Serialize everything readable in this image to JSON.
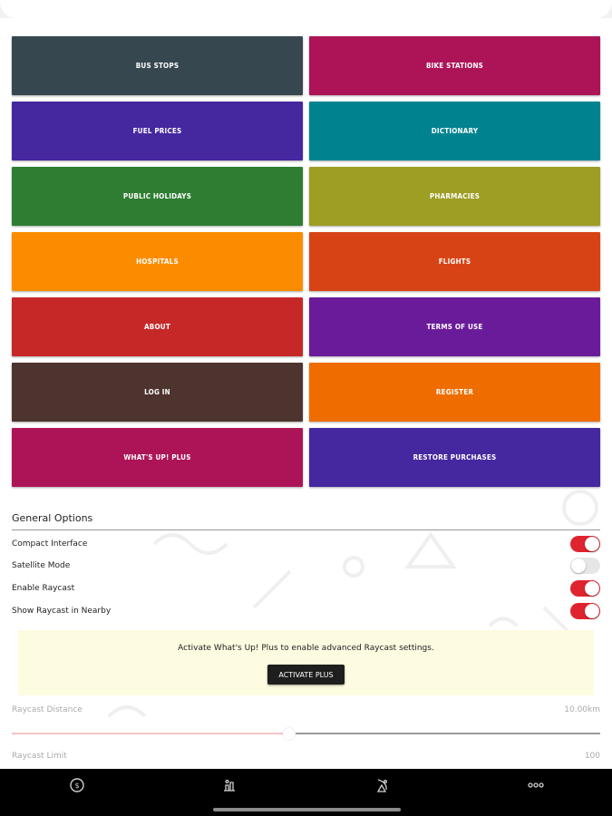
{
  "menu": {
    "tiles": [
      {
        "label": "BUS STOPS",
        "color": "#37474f"
      },
      {
        "label": "BIKE STATIONS",
        "color": "#ad1457"
      },
      {
        "label": "FUEL PRICES",
        "color": "#4527a0"
      },
      {
        "label": "DICTIONARY",
        "color": "#00838f"
      },
      {
        "label": "PUBLIC HOLIDAYS",
        "color": "#2e7d32"
      },
      {
        "label": "PHARMACIES",
        "color": "#9e9d24"
      },
      {
        "label": "HOSPITALS",
        "color": "#fb8c00"
      },
      {
        "label": "FLIGHTS",
        "color": "#d84315"
      },
      {
        "label": "ABOUT",
        "color": "#c62828"
      },
      {
        "label": "TERMS OF USE",
        "color": "#6a1b9a"
      },
      {
        "label": "LOG IN",
        "color": "#4e342e"
      },
      {
        "label": "REGISTER",
        "color": "#ef6c00"
      },
      {
        "label": "WHAT'S UP! PLUS",
        "color": "#ad1457"
      },
      {
        "label": "RESTORE PURCHASES",
        "color": "#4527a0"
      }
    ]
  },
  "options": {
    "title": "General Options",
    "items": [
      {
        "label": "Compact Interface",
        "on": true
      },
      {
        "label": "Satellite Mode",
        "on": false
      },
      {
        "label": "Enable Raycast",
        "on": true
      },
      {
        "label": "Show Raycast in Nearby",
        "on": true
      }
    ],
    "accent_color": "#e0242f"
  },
  "promo": {
    "text": "Activate What's Up! Plus to enable advanced Raycast settings.",
    "button_label": "ACTIVATE PLUS"
  },
  "raycast": {
    "distance_label": "Raycast Distance",
    "distance_value": "10.00km",
    "distance_fraction": 0.47,
    "limit_label": "Raycast Limit",
    "limit_value": "100"
  },
  "bottom_nav": {
    "icons": [
      "money-icon",
      "nearby-icon",
      "satellite-dish-icon",
      "more-icon"
    ]
  }
}
